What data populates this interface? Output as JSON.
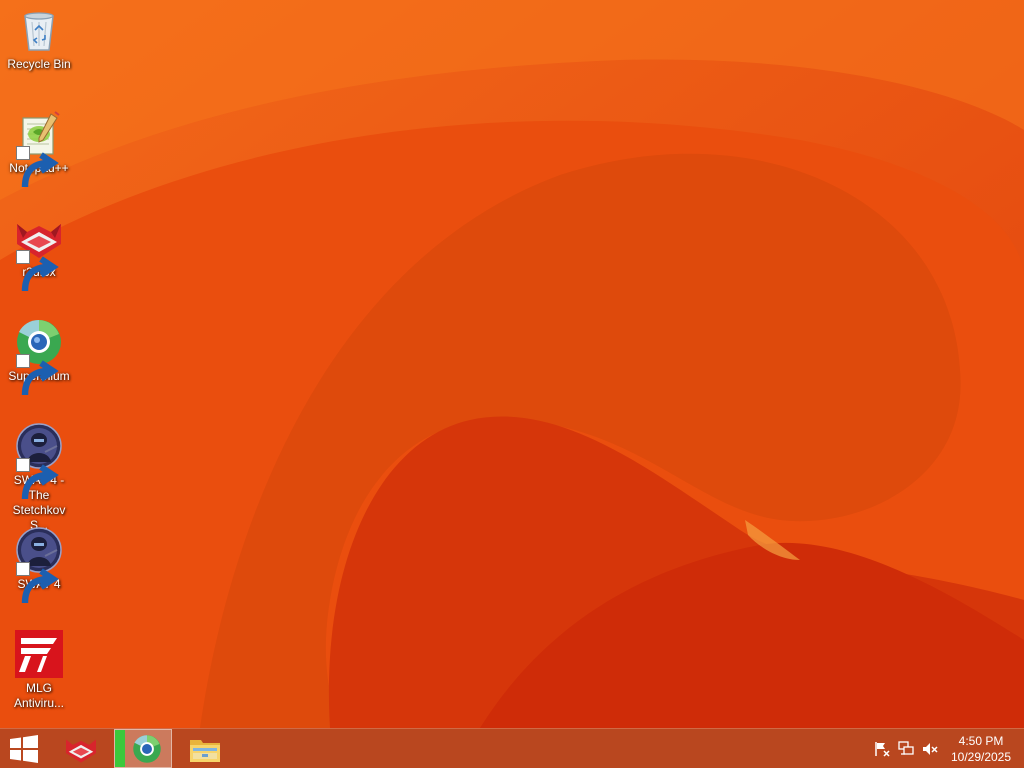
{
  "desktop": {
    "icons": [
      {
        "label": "Recycle Bin",
        "icon": "recycle-bin-icon"
      },
      {
        "label": "Notepad++",
        "icon": "notepad-plus-plus-icon"
      },
      {
        "label": "r3dfox",
        "icon": "r3dfox-icon"
      },
      {
        "label": "Supermium",
        "icon": "supermium-icon"
      },
      {
        "label": "SWAT 4 - The Stetchkov S...",
        "icon": "swat4-stetchkov-icon"
      },
      {
        "label": "SWAT 4",
        "icon": "swat4-icon"
      },
      {
        "label": "MLG Antiviru...",
        "icon": "mlg-antivirus-icon"
      }
    ]
  },
  "taskbar": {
    "start": {
      "icon": "windows-logo-icon"
    },
    "pinned": [
      {
        "app": "r3dfox",
        "icon": "r3dfox-icon",
        "running": false
      },
      {
        "app": "Supermium",
        "icon": "supermium-icon",
        "running": true
      },
      {
        "app": "File Explorer",
        "icon": "folder-icon",
        "running": false
      }
    ],
    "tray": {
      "icons": [
        "action-center-flag-icon",
        "network-icon",
        "speaker-muted-icon"
      ],
      "time": "4:50 PM",
      "date": "10/29/2025"
    }
  },
  "colors": {
    "wallpaper_base": "#e8480c",
    "taskbar": "#b9471f",
    "running_indicator": "#3cc83c"
  }
}
